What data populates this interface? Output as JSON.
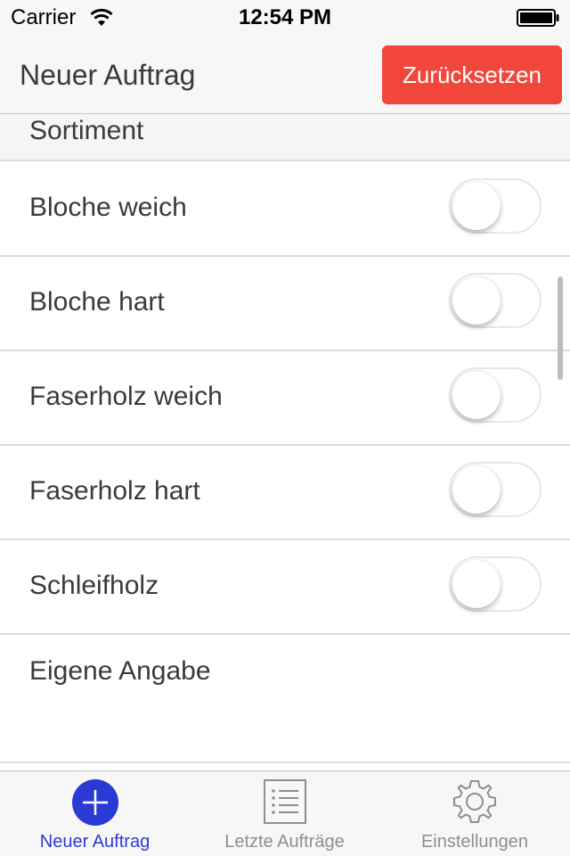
{
  "status_bar": {
    "carrier": "Carrier",
    "time": "12:54 PM"
  },
  "nav": {
    "title": "Neuer Auftrag",
    "reset_label": "Zurücksetzen"
  },
  "section": {
    "title": "Sortiment"
  },
  "rows": [
    {
      "label": "Bloche weich",
      "on": false
    },
    {
      "label": "Bloche hart",
      "on": false
    },
    {
      "label": "Faserholz weich",
      "on": false
    },
    {
      "label": "Faserholz hart",
      "on": false
    },
    {
      "label": "Schleifholz",
      "on": false
    },
    {
      "label": "Eigene Angabe"
    }
  ],
  "tabs": [
    {
      "label": "Neuer Auftrag",
      "icon": "plus-circle-icon",
      "active": true
    },
    {
      "label": "Letzte Aufträge",
      "icon": "list-icon",
      "active": false
    },
    {
      "label": "Einstellungen",
      "icon": "gear-icon",
      "active": false
    }
  ],
  "colors": {
    "accent": "#2a3bd4",
    "reset": "#f0463b",
    "text": "#3a3a3a",
    "inactive": "#8e8e8e"
  }
}
